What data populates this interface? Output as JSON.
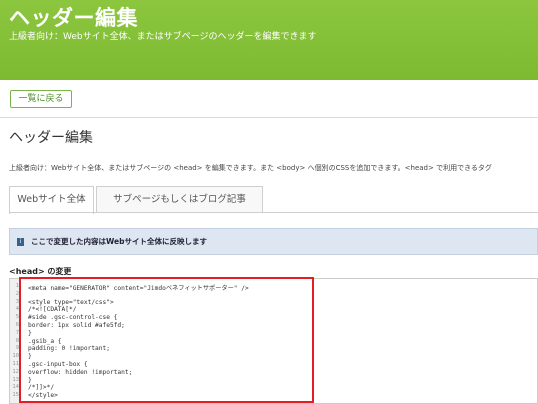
{
  "banner": {
    "title": "ヘッダー編集",
    "subtitle": "上級者向け：Webサイト全体、またはサブページのヘッダーを編集できます"
  },
  "back_button_label": "一覧に戻る",
  "page": {
    "title": "ヘッダー編集",
    "description": "上級者向け：Webサイト全体、またはサブページの <head> を編集できます。また <body> へ個別のCSSを追加できます。<head> で利用できるタグ"
  },
  "tabs": [
    {
      "label": "Webサイト全体"
    },
    {
      "label": "サブページもしくはブログ記事"
    }
  ],
  "notice": {
    "icon": "i",
    "text": "ここで変更した内容はWebサイト全体に反映します"
  },
  "head_label": "<head> の変更",
  "code_lines": [
    {
      "no": "1",
      "text": "<meta name=\"GENERATOR\" content=\"Jimdoベネフィットサポーター\" />"
    },
    {
      "no": "2",
      "text": ""
    },
    {
      "no": "3",
      "text": "<style type=\"text/css\">"
    },
    {
      "no": "4",
      "text": "/*<![CDATA[*/"
    },
    {
      "no": "5",
      "text": "#side .gsc-control-cse {"
    },
    {
      "no": "6",
      "text": "border: 1px solid #afe5fd;"
    },
    {
      "no": "7",
      "text": "}"
    },
    {
      "no": "8",
      "text": ".gsib_a {"
    },
    {
      "no": "9",
      "text": "padding: 0 !important;"
    },
    {
      "no": "10",
      "text": "}"
    },
    {
      "no": "11",
      "text": ".gsc-input-box {"
    },
    {
      "no": "12",
      "text": "overflow: hidden !important;"
    },
    {
      "no": "13",
      "text": "}"
    },
    {
      "no": "14",
      "text": "/*]]>*/"
    },
    {
      "no": "15",
      "text": "</style>"
    }
  ],
  "colors": {
    "banner_green": "#8cc63f",
    "highlight_red": "#e41e25",
    "notice_bg": "#dde6f1"
  }
}
